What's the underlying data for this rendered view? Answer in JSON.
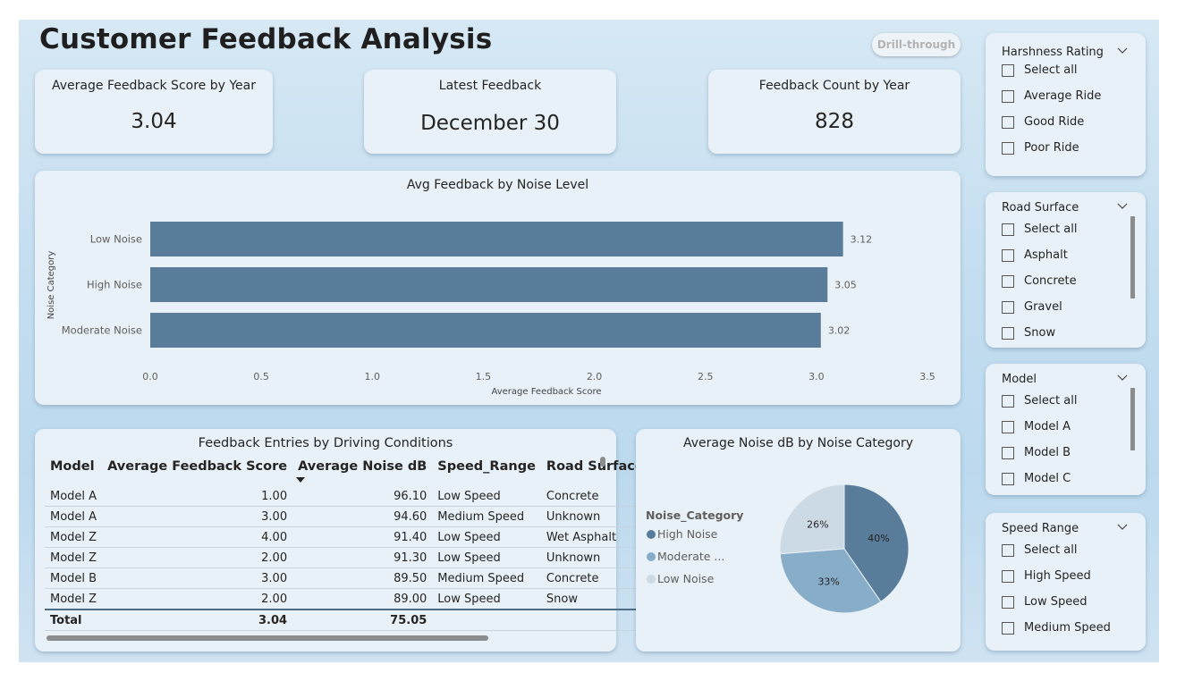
{
  "page_title": "Customer Feedback Analysis",
  "drill_through_label": "Drill-through",
  "kpis": [
    {
      "title": "Average Feedback Score by Year",
      "value": "3.04"
    },
    {
      "title": "Latest Feedback",
      "value": "December 30"
    },
    {
      "title": "Feedback Count by Year",
      "value": "828"
    }
  ],
  "bar_chart": {
    "title": "Avg Feedback by Noise Level",
    "ylabel": "Noise Category",
    "xlabel": "Average Feedback Score"
  },
  "table": {
    "title": "Feedback Entries by Driving Conditions",
    "columns": [
      "Model",
      "Average Feedback Score",
      "Average Noise dB",
      "Speed_Range",
      "Road Surface"
    ],
    "rows": [
      [
        "Model A",
        "1.00",
        "96.10",
        "Low Speed",
        "Concrete"
      ],
      [
        "Model A",
        "3.00",
        "94.60",
        "Medium Speed",
        "Unknown"
      ],
      [
        "Model Z",
        "4.00",
        "91.40",
        "Low Speed",
        "Wet Asphalt"
      ],
      [
        "Model Z",
        "2.00",
        "91.30",
        "Low Speed",
        "Unknown"
      ],
      [
        "Model B",
        "3.00",
        "89.50",
        "Medium Speed",
        "Concrete"
      ],
      [
        "Model Z",
        "2.00",
        "89.00",
        "Low Speed",
        "Snow"
      ]
    ],
    "total": [
      "Total",
      "3.04",
      "75.05",
      "",
      ""
    ]
  },
  "pie_legend_title": "Noise_Category",
  "slicers": [
    {
      "title": "Harshness Rating",
      "items": [
        "Select all",
        "Average Ride",
        "Good Ride",
        "Poor Ride"
      ]
    },
    {
      "title": "Road Surface",
      "items": [
        "Select all",
        "Asphalt",
        "Concrete",
        "Gravel",
        "Snow"
      ]
    },
    {
      "title": "Model",
      "items": [
        "Select all",
        "Model A",
        "Model B",
        "Model C"
      ]
    },
    {
      "title": "Speed Range",
      "items": [
        "Select all",
        "High Speed",
        "Low Speed",
        "Medium Speed"
      ]
    }
  ],
  "colors": {
    "bar": "#587c99",
    "high_noise": "#587c99",
    "moderate_noise": "#88adc9",
    "low_noise": "#ccdae6"
  },
  "chart_data": [
    {
      "type": "bar",
      "orientation": "horizontal",
      "title": "Avg Feedback by Noise Level",
      "xlabel": "Average Feedback Score",
      "ylabel": "Noise Category",
      "categories": [
        "Low Noise",
        "High Noise",
        "Moderate Noise"
      ],
      "values": [
        3.12,
        3.05,
        3.02
      ],
      "data_labels": [
        "3.12",
        "3.05",
        "3.02"
      ],
      "xlim": [
        0,
        3.5
      ],
      "xticks": [
        "0.0",
        "0.5",
        "1.0",
        "1.5",
        "2.0",
        "2.5",
        "3.0",
        "3.5"
      ],
      "grid": false
    },
    {
      "type": "pie",
      "title": "Average Noise dB by Noise Category",
      "legend_title": "Noise_Category",
      "legend_position": "left",
      "categories": [
        "High Noise",
        "Moderate Noise",
        "Low Noise"
      ],
      "legend_labels": [
        "High Noise",
        "Moderate ...",
        "Low Noise"
      ],
      "values": [
        40,
        33,
        26
      ],
      "data_labels": [
        "40%",
        "33%",
        "26%"
      ]
    }
  ]
}
